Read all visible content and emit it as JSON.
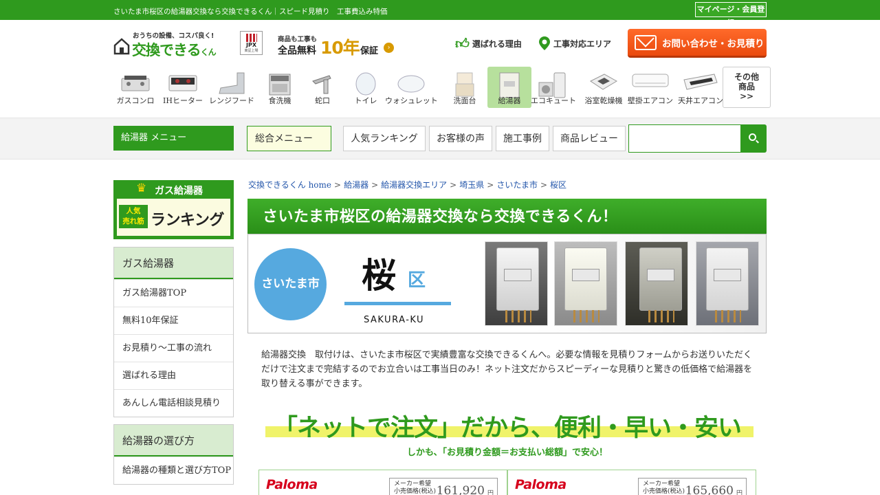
{
  "topbar": {
    "tagline": "さいたま市桜区の給湯器交換なら交換できるくん｜スピード見積り　工事費込み特価",
    "mypage_label": "マイページ・会員登録"
  },
  "header": {
    "logo_catch": "おうちの設備、コスパ良く!",
    "logo_name": "交換できる",
    "logo_suffix": "くん",
    "jpx_label": "JPX",
    "jpx_sub": "東証上場",
    "warranty_line1": "商品も工事も",
    "warranty_line2": "全品無料",
    "warranty_big": "10年",
    "warranty_line3": "保証",
    "reason_label": "選ばれる理由",
    "area_label": "工事対応エリア",
    "contact_label": "お問い合わせ・お見積り"
  },
  "categories": [
    {
      "label": "ガスコンロ",
      "icon": "gas-stove-icon"
    },
    {
      "label": "IHヒーター",
      "icon": "ih-heater-icon"
    },
    {
      "label": "レンジフード",
      "icon": "range-hood-icon"
    },
    {
      "label": "食洗機",
      "icon": "dishwasher-icon"
    },
    {
      "label": "蛇口",
      "icon": "faucet-icon"
    },
    {
      "label": "トイレ",
      "icon": "toilet-icon"
    },
    {
      "label": "ウォシュレット",
      "icon": "washlet-icon"
    },
    {
      "label": "洗面台",
      "icon": "vanity-icon"
    },
    {
      "label": "給湯器",
      "icon": "water-heater-icon",
      "active": true
    },
    {
      "label": "エコキュート",
      "icon": "ecocute-icon"
    },
    {
      "label": "浴室乾燥機",
      "icon": "bath-dryer-icon"
    },
    {
      "label": "壁掛エアコン",
      "icon": "wall-aircon-icon"
    },
    {
      "label": "天井エアコン",
      "icon": "ceiling-aircon-icon"
    }
  ],
  "more_label": "その他\n商品\n>>",
  "menu": {
    "title": "給湯器 メニュー",
    "tabs": [
      "総合メニュー",
      "人気ランキング",
      "お客様の声",
      "施工事例",
      "商品レビュー"
    ],
    "search_value": ""
  },
  "sidebar": {
    "rank_title": "ガス給湯器",
    "rank_badge": "人気\n売れ筋",
    "rank_label": "ランキング",
    "box1": {
      "head": "ガス給湯器",
      "items": [
        "ガス給湯器TOP",
        "無料10年保証",
        "お見積り～工事の流れ",
        "選ばれる理由",
        "あんしん電話相談見積り"
      ]
    },
    "box2": {
      "head": "給湯器の選び方",
      "items": [
        "給湯器の種類と選び方TOP"
      ]
    }
  },
  "breadcrumb": [
    "交換できるくん home",
    "給湯器",
    "給湯器交換エリア",
    "埼玉県",
    "さいたま市",
    "桜区"
  ],
  "main": {
    "title": "さいたま市桜区の給湯器交換なら交換できるくん！",
    "hero_city": "さいたま市",
    "hero_kanji": "桜",
    "hero_ku": "区",
    "hero_romaji": "SAKURA-KU",
    "intro": "給湯器交換　取付けは、さいたま市桜区で実績豊富な交換できるくんへ。必要な情報を見積りフォームからお送りいただくだけで注文まで完結するのでお立合いは工事当日のみ！ネット注文だからスピーディーな見積りと驚きの低価格で給湯器を取り替える事ができます。",
    "catch": "「ネットで注文」だから、便利・早い・安い",
    "catch_sub": "しかも、「お見積り金額＝お支払い総額」で安心！"
  },
  "products": [
    {
      "brand": "Paloma",
      "price_label": "メーカー希望\n小売価格(税込)",
      "price": "161,920",
      "yen": "円"
    },
    {
      "brand": "Paloma",
      "price_label": "メーカー希望\n小売価格(税込)",
      "price": "165,660",
      "yen": "円"
    }
  ],
  "colors": {
    "brand_green": "#2f9a1e",
    "accent_orange": "#ea4a0e",
    "hero_blue": "#56a9df",
    "paloma_red": "#d6001c"
  }
}
